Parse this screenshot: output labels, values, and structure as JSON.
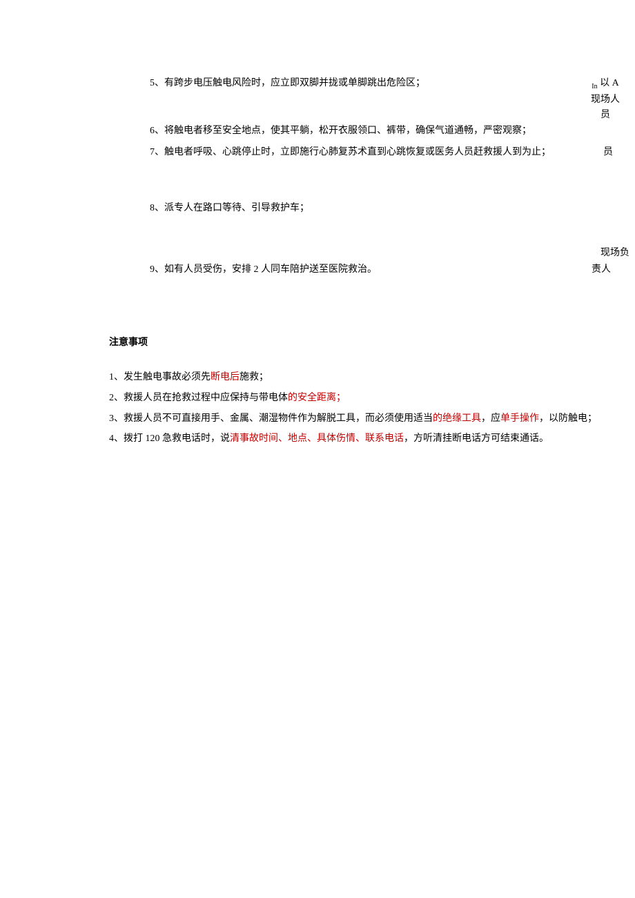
{
  "procedures": {
    "item5": {
      "number": "5、",
      "text": "有跨步电压触电风险时，应立即双脚并拢或单脚跳出危险区；",
      "side_sub": "In",
      "side_line1": " 以 A",
      "side_line2": "现场人",
      "side_line3": "员"
    },
    "item6": {
      "number": "6、",
      "text": "将触电者移至安全地点，使其平躺，松开衣服领口、裤带，确保气道通畅，严密观察；"
    },
    "item7": {
      "number": "7、",
      "text": "触电者呼吸、心跳停止时，立即施行心肺复苏术直到心跳恢复或医务人员赶救援人到为止；",
      "side": "员"
    },
    "item8": {
      "number": "8、",
      "text": "派专人在路口等待、引导救护车；"
    },
    "item9": {
      "number": "9、",
      "text": "如有人员受伤，安排 2 人同车陪护送至医院救治。",
      "side_above": "现场负",
      "side": "责人"
    }
  },
  "notice_title": "注意事项",
  "notices": {
    "n1": {
      "prefix": "1、发生触电事故必须先",
      "red1": "断电后",
      "suffix": "施救；"
    },
    "n2": {
      "prefix": "2、救援人员在抢救过程中应保持与带电体",
      "red1": "的安全距离；"
    },
    "n3": {
      "prefix": "3、救援人员不可直接用手、金属、潮湿物件作为解脱工具，而必须使用适当",
      "red1": "的绝缘工具",
      "mid1": "，应",
      "red2": "单手操作",
      "suffix": "，以防触电；"
    },
    "n4": {
      "prefix": "4、拨打 120 急救电话时，说",
      "red1": "清事故时间、地点、具体伤情、联系电话",
      "suffix": "，方听清挂断电话方可结束通话。"
    }
  }
}
